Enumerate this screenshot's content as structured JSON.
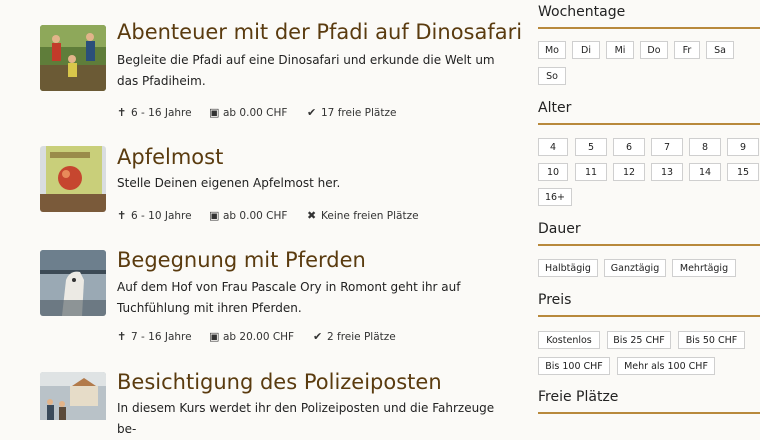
{
  "courses": [
    {
      "title": "Abenteuer mit der Pfadi auf Dinosafari",
      "description": "Begleite die Pfadi auf eine Dinosafari und erkunde die Welt um das Pfadiheim.",
      "age": "6 - 16 Jahre",
      "price": "ab 0.00 CHF",
      "availability": "17 freie Plätze",
      "availability_icon": "check-icon"
    },
    {
      "title": "Apfelmost",
      "description": "Stelle Deinen eigenen Apfelmost her.",
      "age": "6 - 10 Jahre",
      "price": "ab 0.00 CHF",
      "availability": "Keine freien Plätze",
      "availability_icon": "cross-icon"
    },
    {
      "title": "Begegnung mit Pferden",
      "description": "Auf dem Hof von Frau Pascale Ory in Romont geht ihr auf Tuchfühlung mit ihren Pferden.",
      "age": "7 - 16 Jahre",
      "price": "ab 20.00 CHF",
      "availability": "2 freie Plätze",
      "availability_icon": "check-icon"
    },
    {
      "title": "Besichtigung des Polizeiposten",
      "description": "In diesem Kurs werdet ihr den Polizeiposten und die Fahrzeuge be-"
    }
  ],
  "filters": {
    "weekdays": {
      "title": "Wochentage",
      "options": [
        "Mo",
        "Di",
        "Mi",
        "Do",
        "Fr",
        "Sa",
        "So"
      ]
    },
    "age": {
      "title": "Alter",
      "options": [
        "4",
        "5",
        "6",
        "7",
        "8",
        "9",
        "10",
        "11",
        "12",
        "13",
        "14",
        "15",
        "16+"
      ]
    },
    "duration": {
      "title": "Dauer",
      "options": [
        "Halbtägig",
        "Ganztägig",
        "Mehrtägig"
      ]
    },
    "price": {
      "title": "Preis",
      "options": [
        "Kostenlos",
        "Bis 25 CHF",
        "Bis 50 CHF",
        "Bis 100 CHF",
        "Mehr als 100 CHF"
      ]
    },
    "free_places": {
      "title": "Freie Plätze"
    }
  },
  "colors": {
    "accent": "#b8893c",
    "title": "#5a3b0f"
  }
}
